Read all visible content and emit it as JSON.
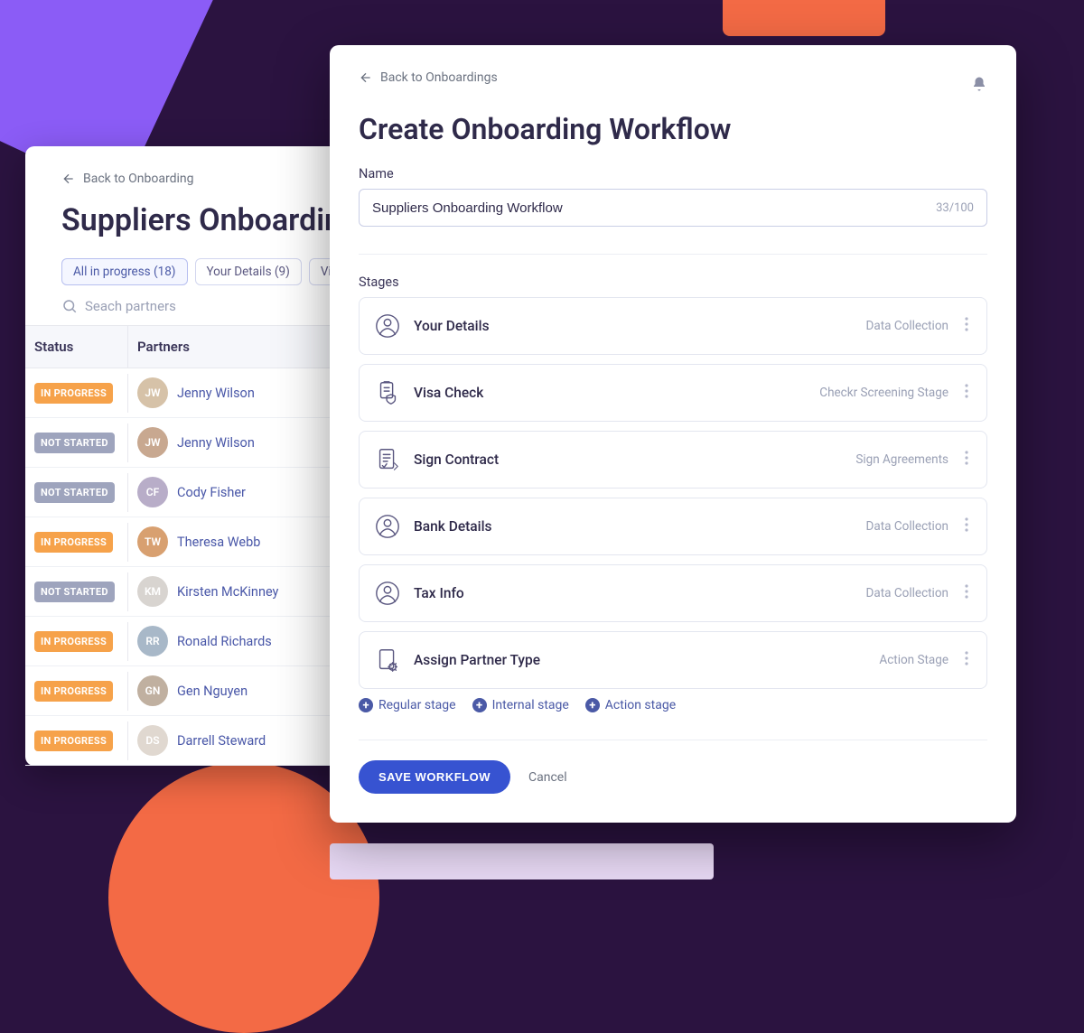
{
  "back_panel": {
    "back_link": "Back to Onboarding",
    "title": "Suppliers Onboarding",
    "filters": [
      {
        "label": "All in progress (18)",
        "active": true
      },
      {
        "label": "Your Details (9)",
        "active": false
      },
      {
        "label": "Visa Check",
        "active": false
      }
    ],
    "search_placeholder": "Seach partners",
    "table": {
      "col_status": "Status",
      "col_partners": "Partners"
    },
    "rows": [
      {
        "status": "IN PROGRESS",
        "status_kind": "inprogress",
        "name": "Jenny Wilson",
        "avatar_hue": "#d6c2a8"
      },
      {
        "status": "NOT STARTED",
        "status_kind": "notstarted",
        "name": "Jenny Wilson",
        "avatar_hue": "#c8a890"
      },
      {
        "status": "NOT STARTED",
        "status_kind": "notstarted",
        "name": "Cody Fisher",
        "avatar_hue": "#b8adc8"
      },
      {
        "status": "IN PROGRESS",
        "status_kind": "inprogress",
        "name": "Theresa Webb",
        "avatar_hue": "#d8a070"
      },
      {
        "status": "NOT STARTED",
        "status_kind": "notstarted",
        "name": "Kirsten McKinney",
        "avatar_hue": "#d8d4d0"
      },
      {
        "status": "IN PROGRESS",
        "status_kind": "inprogress",
        "name": "Ronald Richards",
        "avatar_hue": "#a8b8c8"
      },
      {
        "status": "IN PROGRESS",
        "status_kind": "inprogress",
        "name": "Gen Nguyen",
        "avatar_hue": "#c0b0a0"
      },
      {
        "status": "IN PROGRESS",
        "status_kind": "inprogress",
        "name": "Darrell Steward",
        "avatar_hue": "#e0d8d0"
      }
    ]
  },
  "front_panel": {
    "back_link": "Back to Onboardings",
    "title": "Create Onboarding Workflow",
    "name_label": "Name",
    "name_value": "Suppliers Onboarding Workflow",
    "char_count": "33/100",
    "stages_label": "Stages",
    "stages": [
      {
        "title": "Your Details",
        "type": "Data Collection",
        "icon": "person"
      },
      {
        "title": "Visa Check",
        "type": "Checkr Screening Stage",
        "icon": "shield"
      },
      {
        "title": "Sign Contract",
        "type": "Sign Agreements",
        "icon": "sign"
      },
      {
        "title": "Bank Details",
        "type": "Data Collection",
        "icon": "person"
      },
      {
        "title": "Tax Info",
        "type": "Data Collection",
        "icon": "person"
      },
      {
        "title": "Assign Partner Type",
        "type": "Action Stage",
        "icon": "gear"
      }
    ],
    "add_stage_links": [
      "Regular stage",
      "Internal stage",
      "Action  stage"
    ],
    "primary_action": "SAVE WORKFLOW",
    "secondary_action": "Cancel"
  }
}
